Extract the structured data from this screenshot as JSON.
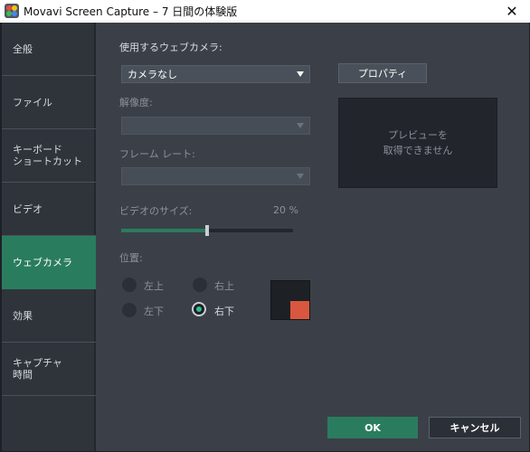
{
  "titlebar": {
    "title": "Movavi Screen Capture – 7 日間の体験版",
    "close_glyph": "✕",
    "icon": "movavi-app-icon"
  },
  "sidebar": {
    "items": [
      {
        "label": "全般",
        "active": false
      },
      {
        "label": "ファイル",
        "active": false
      },
      {
        "label": "キーボード\n ショートカット",
        "active": false
      },
      {
        "label": "ビデオ",
        "active": false
      },
      {
        "label": "ウェブカメラ",
        "active": true
      },
      {
        "label": "効果",
        "active": false
      },
      {
        "label": "キャプチャ\n時間",
        "active": false
      }
    ]
  },
  "webcam": {
    "camera_label": "使用するウェブカメラ:",
    "camera_value": "カメラなし",
    "properties_button": "プロパティ",
    "resolution_label": "解像度:",
    "resolution_value": "",
    "framerate_label": "フレーム レート:",
    "framerate_value": "",
    "preview_text": "プレビューを\n取得できません",
    "size_label": "ビデオのサイズ:",
    "size_value": "20 %",
    "size_percent": 50,
    "position_label": "位置:",
    "positions": {
      "top_left": "左上",
      "top_right": "右上",
      "bottom_left": "左下",
      "bottom_right": "右下",
      "selected": "bottom_right"
    }
  },
  "footer": {
    "ok_label": "OK",
    "cancel_label": "キャンセル"
  },
  "colors": {
    "accent": "#2a7c5f",
    "panel": "#3b4048",
    "sidebar": "#2f343b",
    "camera_marker": "#d9573e"
  }
}
